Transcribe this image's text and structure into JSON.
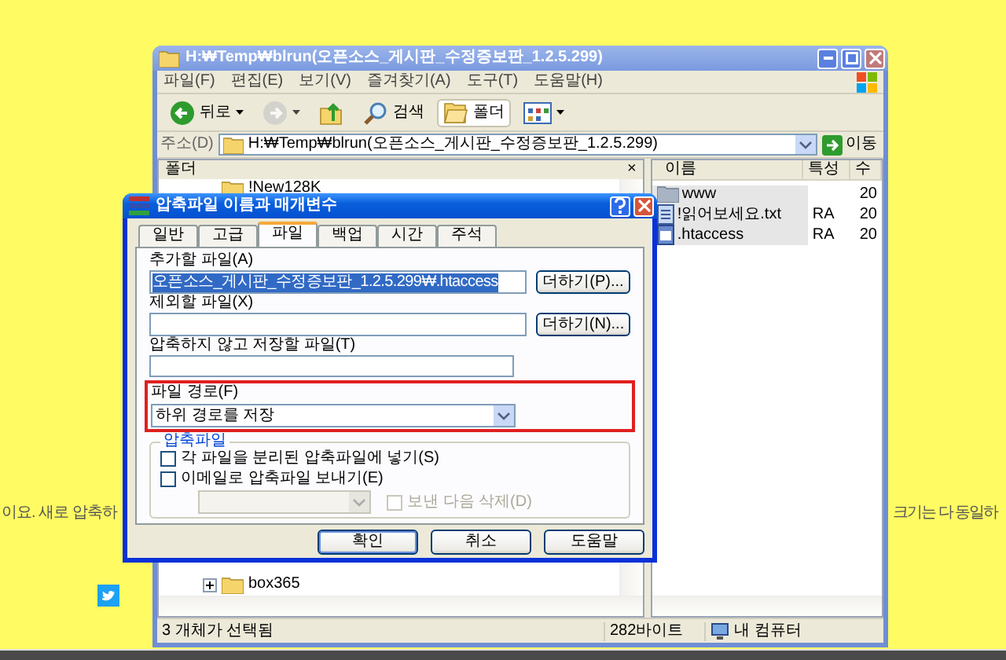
{
  "page_text": [
    "이요. 새로 압축하",
    "크기는 다 동일하"
  ],
  "explorer": {
    "title": "H:₩Temp₩blrun(오픈소스_게시판_수정증보판_1.2.5.299)",
    "menu": [
      "파일(F)",
      "편집(E)",
      "보기(V)",
      "즐겨찾기(A)",
      "도구(T)",
      "도움말(H)"
    ],
    "toolbar": [
      {
        "kind": "back",
        "label": "뒤로",
        "pressed": false,
        "disabled": false,
        "dropdown": true
      },
      {
        "kind": "forward",
        "pressed": false,
        "disabled": true,
        "dropdown": true
      },
      {
        "kind": "up",
        "pressed": false,
        "disabled": false,
        "dropdown": false
      },
      {
        "kind": "search",
        "label": "검색",
        "pressed": false,
        "disabled": false,
        "dropdown": false
      },
      {
        "kind": "folders",
        "label": "폴더",
        "pressed": true,
        "disabled": false,
        "dropdown": false
      },
      {
        "kind": "views",
        "pressed": false,
        "disabled": false,
        "dropdown": true
      }
    ],
    "address": {
      "label": "주소(D)",
      "value": "H:₩Temp₩blrun(오픈소스_게시판_수정증보판_1.2.5.299)",
      "go": "이동"
    },
    "folders_pane": {
      "title": "폴더",
      "close": "×",
      "items": [
        {
          "label": "!New128K",
          "expandable": false
        },
        {
          "label": "box365",
          "expandable": true
        }
      ]
    },
    "files_pane": {
      "columns": [
        "이름",
        "특성",
        "수"
      ],
      "rows": [
        {
          "kind": "folder",
          "name": "www",
          "date": "20",
          "selected": true
        },
        {
          "kind": "text",
          "name": "!읽어보세요.txt",
          "attributes": "RA",
          "date": "20",
          "selected": true
        },
        {
          "kind": "file",
          "name": ".htaccess",
          "attributes": "RA",
          "date": "20",
          "selected": true
        }
      ]
    },
    "status_bar": {
      "selection": "3 개체가 선택됨",
      "size": "282바이트",
      "location": "내 컴퓨터"
    }
  },
  "dialog": {
    "title": "압축파일 이름과 매개변수",
    "tabs": [
      {
        "label": "일반",
        "selected": false
      },
      {
        "label": "고급",
        "selected": false
      },
      {
        "label": "파일",
        "selected": true
      },
      {
        "label": "백업",
        "selected": false
      },
      {
        "label": "시간",
        "selected": false
      },
      {
        "label": "주석",
        "selected": false
      }
    ],
    "add_files": {
      "label": "추가할 파일(A)",
      "value": "오픈소스_게시판_수정증보판_1.2.5.299₩.htaccess",
      "value_selected": true,
      "button": "더하기(P)..."
    },
    "exclude_files": {
      "label": "제외할 파일(X)",
      "button": "더하기(N)..."
    },
    "store_files": {
      "label": "압축하지 않고 저장할 파일(T)"
    },
    "file_paths": {
      "label": "파일 경로(F)",
      "value": "하위 경로를 저장",
      "highlighted": true
    },
    "archives": {
      "title": "압축파일",
      "options": [
        {
          "label": "각 파일을 분리된 압축파일에 넣기(S)",
          "checked": false,
          "disabled": false
        },
        {
          "label": "이메일로 압축파일 보내기(E)",
          "checked": false,
          "disabled": false
        }
      ],
      "delete_after": {
        "label": "보낸 다음 삭제(D)",
        "checked": false,
        "disabled": true
      }
    },
    "buttons": [
      "확인",
      "취소",
      "도움말"
    ]
  }
}
